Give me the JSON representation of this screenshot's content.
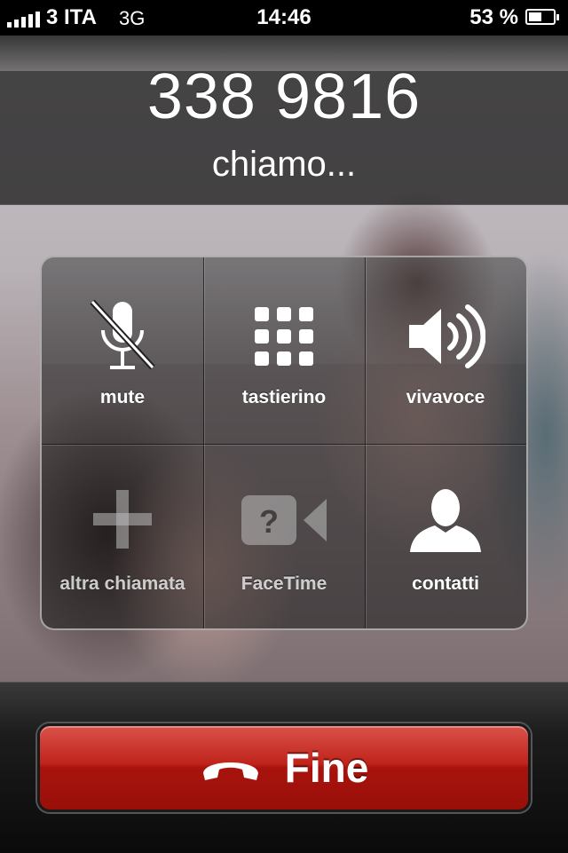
{
  "status_bar": {
    "signal_bars": 5,
    "carrier": "3 ITA",
    "network": "3G",
    "time": "14:46",
    "battery_percent": "53 %",
    "battery_level": 0.53
  },
  "call": {
    "number": "338 9816",
    "status": "chiamo..."
  },
  "controls": {
    "mute": "mute",
    "keypad": "tastierino",
    "speaker": "vivavoce",
    "add_call": "altra chiamata",
    "facetime": "FaceTime",
    "contacts": "contatti"
  },
  "end_call": {
    "label": "Fine",
    "color": "#c0241b"
  }
}
